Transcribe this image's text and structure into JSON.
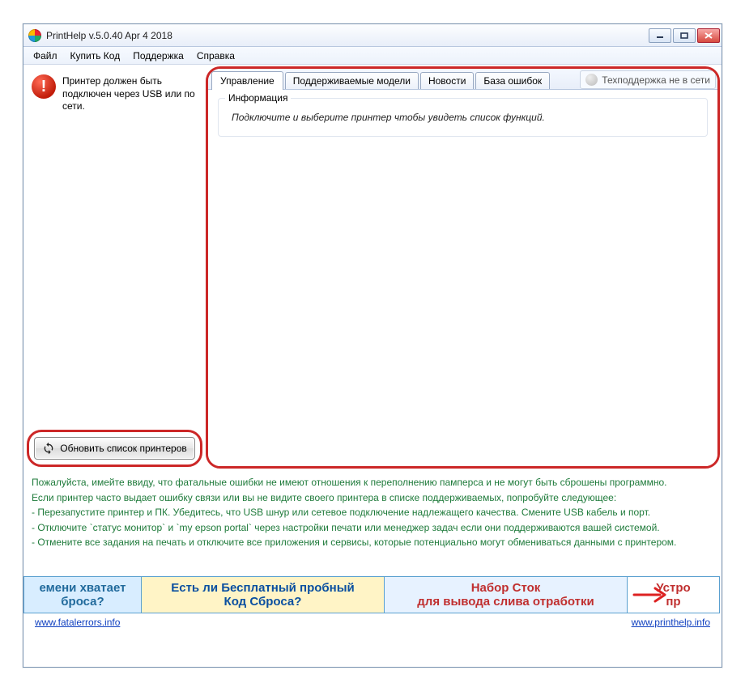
{
  "title": "PrintHelp v.5.0.40 Apr  4 2018",
  "menu": {
    "file": "Файл",
    "buy": "Купить Код",
    "support": "Поддержка",
    "help": "Справка"
  },
  "notice": "Принтер должен быть подключен через USB или по сети.",
  "refresh_label": "Обновить список принтеров",
  "tabs": {
    "control": "Управление",
    "models": "Поддерживаемые модели",
    "news": "Новости",
    "errors": "База ошибок"
  },
  "support_status": "Техподдержка не в сети",
  "groupbox_title": "Информация",
  "group_msg": "Подключите и выберите принтер чтобы увидеть список функций.",
  "tips": {
    "t1": "Пожалуйста, имейте ввиду, что фатальные ошибки не имеют отношения к переполнению памперса и не могут быть сброшены программно.",
    "t2": "Если принтер часто выдает ошибку связи или вы не видите своего принтера в списке поддерживаемых, попробуйте следующее:",
    "t3": "- Перезапустите принтер и ПК. Убедитесь, что USB шнур или сетевое подключение надлежащего качества. Смените USB кабель и порт.",
    "t4": "- Отключите `статус монитор` и `my epson portal` через настройки печати или менеджер задач если они поддерживаются вашей системой.",
    "t5": "- Отмените все задания на печать и отключите все приложения и сервисы, которые потенциально могут обмениваться данными с принтером."
  },
  "ads": {
    "a1": "емени хватает\nброса?",
    "a2": "Есть ли Бесплатный пробный\nКод Сброса?",
    "a3": "Набор Сток\nдля вывода слива отработки",
    "a4": "Устро\nпр"
  },
  "footer": {
    "left": "www.fatalerrors.info",
    "right": "www.printhelp.info"
  }
}
